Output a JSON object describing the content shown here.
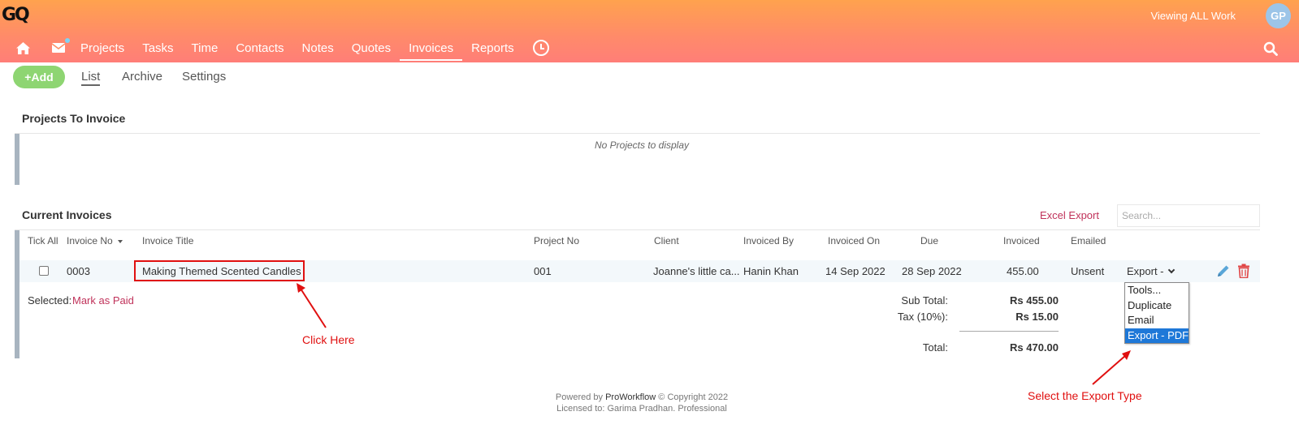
{
  "header": {
    "logo": "GQ",
    "viewing": "Viewing ALL Work",
    "avatar": "GP"
  },
  "nav": {
    "items": [
      "Projects",
      "Tasks",
      "Time",
      "Contacts",
      "Notes",
      "Quotes",
      "Invoices",
      "Reports"
    ],
    "active": "Invoices"
  },
  "subnav": {
    "add_label": "Add",
    "list": "List",
    "archive": "Archive",
    "settings": "Settings"
  },
  "projects_to_invoice": {
    "title": "Projects To Invoice",
    "empty_message": "No Projects to display"
  },
  "current_invoices": {
    "title": "Current Invoices",
    "excel_export": "Excel Export",
    "search_placeholder": "Search...",
    "columns": {
      "tick_all": "Tick All",
      "invoice_no": "Invoice No",
      "invoice_title": "Invoice Title",
      "project_no": "Project No",
      "client": "Client",
      "invoiced_by": "Invoiced By",
      "invoiced_on": "Invoiced On",
      "due": "Due",
      "invoiced": "Invoiced",
      "emailed": "Emailed"
    },
    "row": {
      "invoice_no": "0003",
      "invoice_title": "Making Themed Scented Candles",
      "project_no": "001",
      "client": "Joanne's little ca...",
      "invoiced_by": "Hanin Khan",
      "invoiced_on": "14 Sep 2022",
      "due": "28 Sep 2022",
      "invoiced": "455.00",
      "emailed": "Unsent",
      "export_value": "Export -"
    },
    "export_options": [
      "Tools...",
      "Duplicate",
      "Email",
      "Export - PDF"
    ],
    "selected_option": "Export - PDF",
    "selected_label": "Selected:",
    "mark_as_paid": "Mark as Paid",
    "totals": {
      "sub_total_label": "Sub Total:",
      "sub_total": "Rs 455.00",
      "tax_label": "Tax (10%):",
      "tax": "Rs 15.00",
      "total_label": "Total:",
      "total": "Rs 470.00"
    }
  },
  "annotations": {
    "click_here": "Click Here",
    "select_export": "Select the Export Type"
  },
  "footer": {
    "powered_prefix": "Powered by",
    "brand": "ProWorkflow",
    "copyright": "© Copyright 2022",
    "licensed": "Licensed to: Garima Pradhan. Professional"
  },
  "colors": {
    "header_gradient_start": "#ffa24e",
    "header_gradient_end": "#ff7e78",
    "add_button": "#8ed572",
    "link": "#c0325a",
    "annotation": "#e01010",
    "selected_option": "#1e78d8"
  }
}
